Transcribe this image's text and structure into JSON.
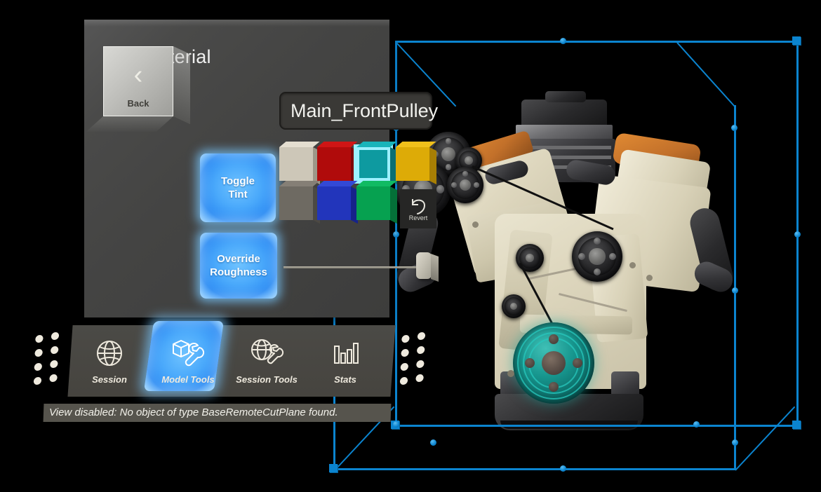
{
  "app": {
    "viewport_background": "#000000",
    "selection_color": "#0b84cf"
  },
  "panel": {
    "title": "Edit Material",
    "back_button": {
      "label": "Back",
      "icon": "chevron-left-icon"
    },
    "material_name": "Main_FrontPulley",
    "toggles": [
      {
        "id": "toggle-tint",
        "line1": "Toggle",
        "line2": "Tint",
        "state": "on"
      },
      {
        "id": "override-roughness",
        "line1": "Override",
        "line2": "Roughness",
        "state": "on"
      }
    ],
    "swatches_row1": [
      {
        "name": "cream",
        "color": "#cdc7b8",
        "side": "#9d9788",
        "top": "#e4ded0",
        "selected": false
      },
      {
        "name": "red",
        "color": "#b00b0b",
        "side": "#7d0707",
        "top": "#cf1515",
        "selected": false
      },
      {
        "name": "teal",
        "color": "#0e9aa0",
        "side": "#0a6f74",
        "top": "#19b4ba",
        "selected": true
      },
      {
        "name": "gold",
        "color": "#ddab07",
        "side": "#a87f04",
        "top": "#f0c01b",
        "selected": false
      }
    ],
    "swatches_row2": [
      {
        "name": "gray",
        "color": "#6e6a62",
        "side": "#4c4943",
        "top": "#857f76",
        "selected": false
      },
      {
        "name": "blue",
        "color": "#2235bb",
        "side": "#16238a",
        "top": "#3349d6",
        "selected": false
      },
      {
        "name": "green",
        "color": "#06a150",
        "side": "#047038",
        "top": "#10bb63",
        "selected": false
      }
    ],
    "revert_button": {
      "label": "Revert",
      "icon": "undo-arrow-icon"
    },
    "roughness_slider": {
      "value_percent": 100
    }
  },
  "toolbar": {
    "items": [
      {
        "label": "Session",
        "icon": "globe-icon",
        "selected": false
      },
      {
        "label": "Model Tools",
        "icon": "cube-wrench-icon",
        "selected": true
      },
      {
        "label": "Session Tools",
        "icon": "globe-wrench-icon",
        "selected": false
      },
      {
        "label": "Stats",
        "icon": "bar-chart-icon",
        "selected": false
      }
    ],
    "grip_left": "drag-handle-left",
    "grip_right": "drag-handle-right"
  },
  "status": {
    "message": "View disabled: No object of type BaseRemoteCutPlane found."
  },
  "model": {
    "name": "v-engine-model",
    "tinted_part": "Main_FrontPulley",
    "tint_color": "#0e9aa0"
  }
}
